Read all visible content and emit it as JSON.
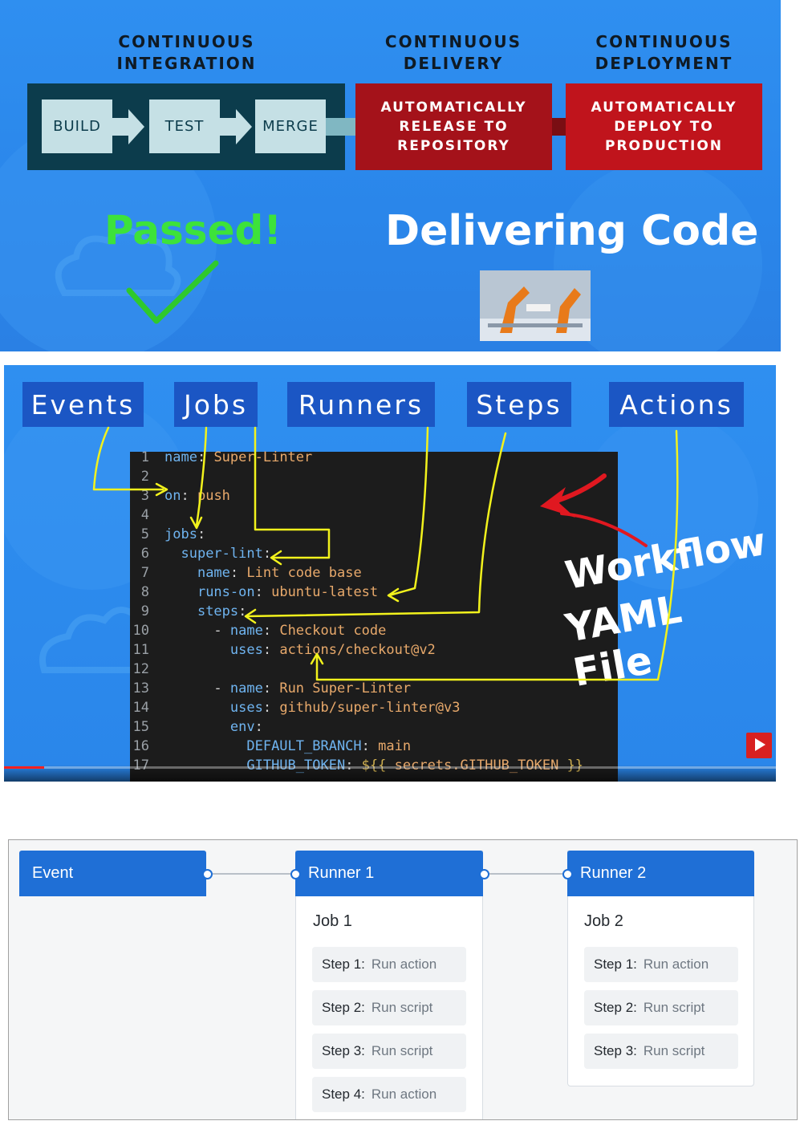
{
  "panel1": {
    "headers": [
      [
        "CONTINUOUS",
        "INTEGRATION"
      ],
      [
        "CONTINUOUS",
        "DELIVERY"
      ],
      [
        "CONTINUOUS",
        "DEPLOYMENT"
      ]
    ],
    "ci_steps": [
      "BUILD",
      "TEST",
      "MERGE"
    ],
    "delivery_box": [
      "AUTOMATICALLY",
      "RELEASE TO",
      "REPOSITORY"
    ],
    "deploy_box": [
      "AUTOMATICALLY",
      "DEPLOY TO",
      "PRODUCTION"
    ],
    "passed": "Passed!",
    "delivering": "Delivering Code",
    "colors": {
      "ci_dark": "#0c3c4c",
      "ci_step": "#c5e0e5",
      "red": "#a4121a",
      "red2": "#c0141c",
      "green": "#3de23a"
    }
  },
  "panel2": {
    "labels": [
      "Events",
      "Jobs",
      "Runners",
      "Steps",
      "Actions"
    ],
    "code": [
      {
        "n": "1",
        "parts": [
          [
            "k",
            "name"
          ],
          [
            "p",
            ": "
          ],
          [
            "v",
            "Super-Linter"
          ]
        ]
      },
      {
        "n": "2",
        "parts": []
      },
      {
        "n": "3",
        "parts": [
          [
            "k",
            "on"
          ],
          [
            "p",
            ": "
          ],
          [
            "v",
            "push"
          ]
        ]
      },
      {
        "n": "4",
        "parts": []
      },
      {
        "n": "5",
        "parts": [
          [
            "k",
            "jobs"
          ],
          [
            "p",
            ":"
          ]
        ]
      },
      {
        "n": "6",
        "parts": [
          [
            "p",
            "  "
          ],
          [
            "k",
            "super-lint"
          ],
          [
            "p",
            ":"
          ]
        ]
      },
      {
        "n": "7",
        "parts": [
          [
            "p",
            "    "
          ],
          [
            "k",
            "name"
          ],
          [
            "p",
            ": "
          ],
          [
            "v",
            "Lint code base"
          ]
        ]
      },
      {
        "n": "8",
        "parts": [
          [
            "p",
            "    "
          ],
          [
            "k",
            "runs-on"
          ],
          [
            "p",
            ": "
          ],
          [
            "v",
            "ubuntu-latest"
          ]
        ]
      },
      {
        "n": "9",
        "parts": [
          [
            "p",
            "    "
          ],
          [
            "k",
            "steps"
          ],
          [
            "p",
            ":"
          ]
        ]
      },
      {
        "n": "10",
        "parts": [
          [
            "p",
            "      - "
          ],
          [
            "k",
            "name"
          ],
          [
            "p",
            ": "
          ],
          [
            "v",
            "Checkout code"
          ]
        ]
      },
      {
        "n": "11",
        "parts": [
          [
            "p",
            "        "
          ],
          [
            "k",
            "uses"
          ],
          [
            "p",
            ": "
          ],
          [
            "v",
            "actions/checkout@v2"
          ]
        ]
      },
      {
        "n": "12",
        "parts": []
      },
      {
        "n": "13",
        "parts": [
          [
            "p",
            "      - "
          ],
          [
            "k",
            "name"
          ],
          [
            "p",
            ": "
          ],
          [
            "v",
            "Run Super-Linter"
          ]
        ]
      },
      {
        "n": "14",
        "parts": [
          [
            "p",
            "        "
          ],
          [
            "k",
            "uses"
          ],
          [
            "p",
            ": "
          ],
          [
            "v",
            "github/super-linter@v3"
          ]
        ]
      },
      {
        "n": "15",
        "parts": [
          [
            "p",
            "        "
          ],
          [
            "k",
            "env"
          ],
          [
            "p",
            ":"
          ]
        ]
      },
      {
        "n": "16",
        "parts": [
          [
            "p",
            "          "
          ],
          [
            "k",
            "DEFAULT_BRANCH"
          ],
          [
            "p",
            ": "
          ],
          [
            "v",
            "main"
          ]
        ]
      },
      {
        "n": "17",
        "parts": [
          [
            "p",
            "          "
          ],
          [
            "k",
            "GITHUB_TOKEN"
          ],
          [
            "p",
            ": "
          ],
          [
            "t",
            "${{ "
          ],
          [
            "v",
            "secrets.GITHUB_TOKEN"
          ],
          [
            "t",
            " }}"
          ]
        ]
      }
    ],
    "workflow_lines": [
      "Workflow",
      "YAML File"
    ],
    "colors": {
      "label_bg": "#1b56c4",
      "arrow_yellow": "#f2f21c",
      "arrow_red": "#e01820"
    }
  },
  "panel3": {
    "event": "Event",
    "runners": [
      {
        "title": "Runner 1",
        "job": "Job 1",
        "steps": [
          [
            "Step 1:",
            "Run action"
          ],
          [
            "Step 2:",
            "Run script"
          ],
          [
            "Step 3:",
            "Run script"
          ],
          [
            "Step 4:",
            "Run action"
          ]
        ]
      },
      {
        "title": "Runner 2",
        "job": "Job 2",
        "steps": [
          [
            "Step 1:",
            "Run action"
          ],
          [
            "Step 2:",
            "Run script"
          ],
          [
            "Step 3:",
            "Run script"
          ]
        ]
      }
    ],
    "colors": {
      "blue": "#1f6fd6"
    }
  }
}
